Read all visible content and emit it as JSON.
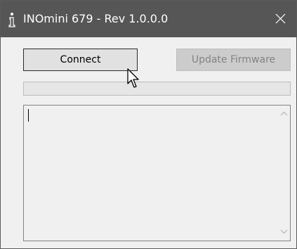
{
  "window": {
    "title": "INOmini 679 - Rev 1.0.0.0",
    "close_icon": "close-icon",
    "app_icon": "info-i-icon"
  },
  "toolbar": {
    "connect_label": "Connect",
    "update_firmware_label": "Update Firmware",
    "update_firmware_enabled": false
  },
  "progress": {
    "value": 0
  },
  "log": {
    "text": "",
    "scroll_up_icon": "chevron-up-icon",
    "scroll_down_icon": "chevron-down-icon"
  },
  "colors": {
    "titlebar": "#565656",
    "window_bg": "#f0f0f0",
    "disabled_text": "#838383"
  }
}
